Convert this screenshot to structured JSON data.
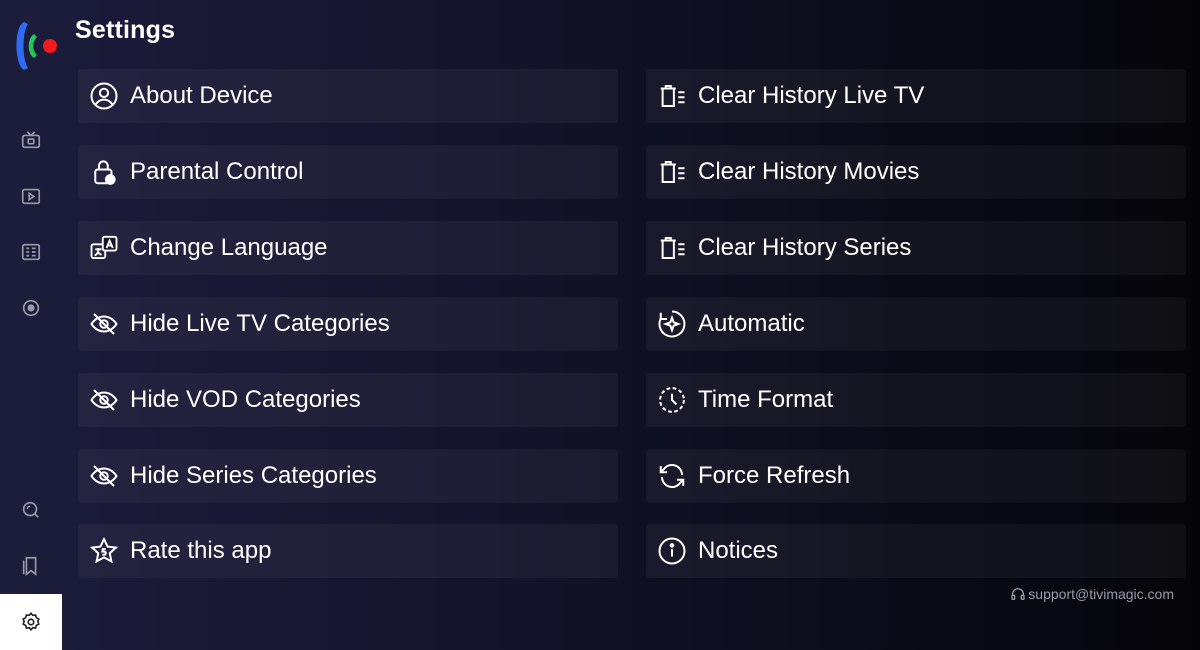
{
  "header": {
    "title": "Settings"
  },
  "colors": {
    "accent_green": "#22c55e",
    "accent_blue": "#2f6cf6",
    "accent_red": "#ef1b1b",
    "active_bg": "#ffffff"
  },
  "sidebar": {
    "items": [
      {
        "name": "live-tv",
        "icon": "tv-icon"
      },
      {
        "name": "movies",
        "icon": "play-icon"
      },
      {
        "name": "series",
        "icon": "series-icon"
      },
      {
        "name": "record",
        "icon": "record-icon"
      },
      {
        "name": "search",
        "icon": "search-icon"
      },
      {
        "name": "favorites",
        "icon": "bookmark-icon"
      },
      {
        "name": "settings",
        "icon": "gear-icon",
        "active": true
      }
    ]
  },
  "settings": {
    "left": [
      {
        "label": "About Device",
        "icon": "user-circle-icon"
      },
      {
        "label": "Parental Control",
        "icon": "lock-icon"
      },
      {
        "label": "Change Language",
        "icon": "language-icon"
      },
      {
        "label": "Hide Live TV Categories",
        "icon": "eye-off-icon"
      },
      {
        "label": "Hide VOD Categories",
        "icon": "eye-off-icon"
      },
      {
        "label": "Hide Series Categories",
        "icon": "eye-off-icon"
      },
      {
        "label": "Rate this app",
        "icon": "star-icon"
      }
    ],
    "right": [
      {
        "label": "Clear History Live TV",
        "icon": "trash-list-icon"
      },
      {
        "label": "Clear History Movies",
        "icon": "trash-list-icon"
      },
      {
        "label": "Clear History Series",
        "icon": "trash-list-icon"
      },
      {
        "label": "Automatic",
        "icon": "auto-sparkle-icon"
      },
      {
        "label": "Time Format",
        "icon": "clock-icon"
      },
      {
        "label": "Force Refresh",
        "icon": "refresh-icon"
      },
      {
        "label": "Notices",
        "icon": "info-icon"
      }
    ]
  },
  "footer": {
    "support_email": "support@tivimagic.com",
    "support_icon": "headset-icon"
  }
}
